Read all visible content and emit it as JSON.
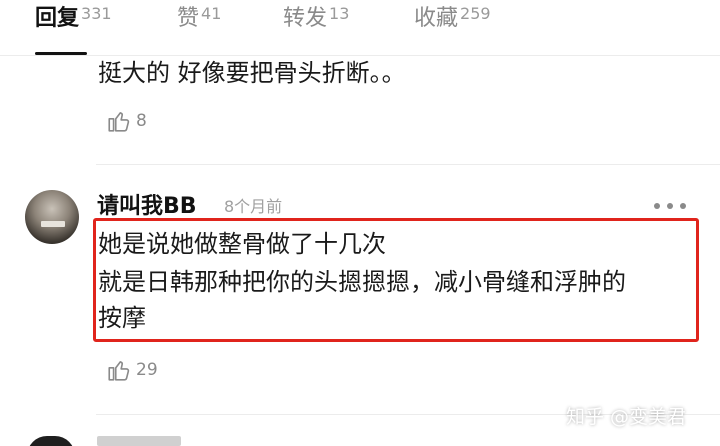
{
  "tabs": [
    {
      "label": "回复",
      "count": "331"
    },
    {
      "label": "赞",
      "count": "41"
    },
    {
      "label": "转发",
      "count": "13"
    },
    {
      "label": "收藏",
      "count": "259"
    }
  ],
  "prev_comment": {
    "text": "挺大的 好像要把骨头折断。。",
    "likes": "8"
  },
  "comment": {
    "username": "请叫我BB",
    "time": "8个月前",
    "lines": [
      "她是说她做整骨做了十几次",
      "就是日韩那种把你的头摁摁摁，减小骨缝和浮肿的",
      "按摩"
    ],
    "likes": "29"
  },
  "watermark": "知乎 @变美君",
  "colors": {
    "highlight_border": "#e0241c",
    "text": "#1a1a1a",
    "muted": "#8a8a8a"
  },
  "icons": {
    "like": "thumbs-up-icon",
    "more": "more-dots-icon"
  }
}
